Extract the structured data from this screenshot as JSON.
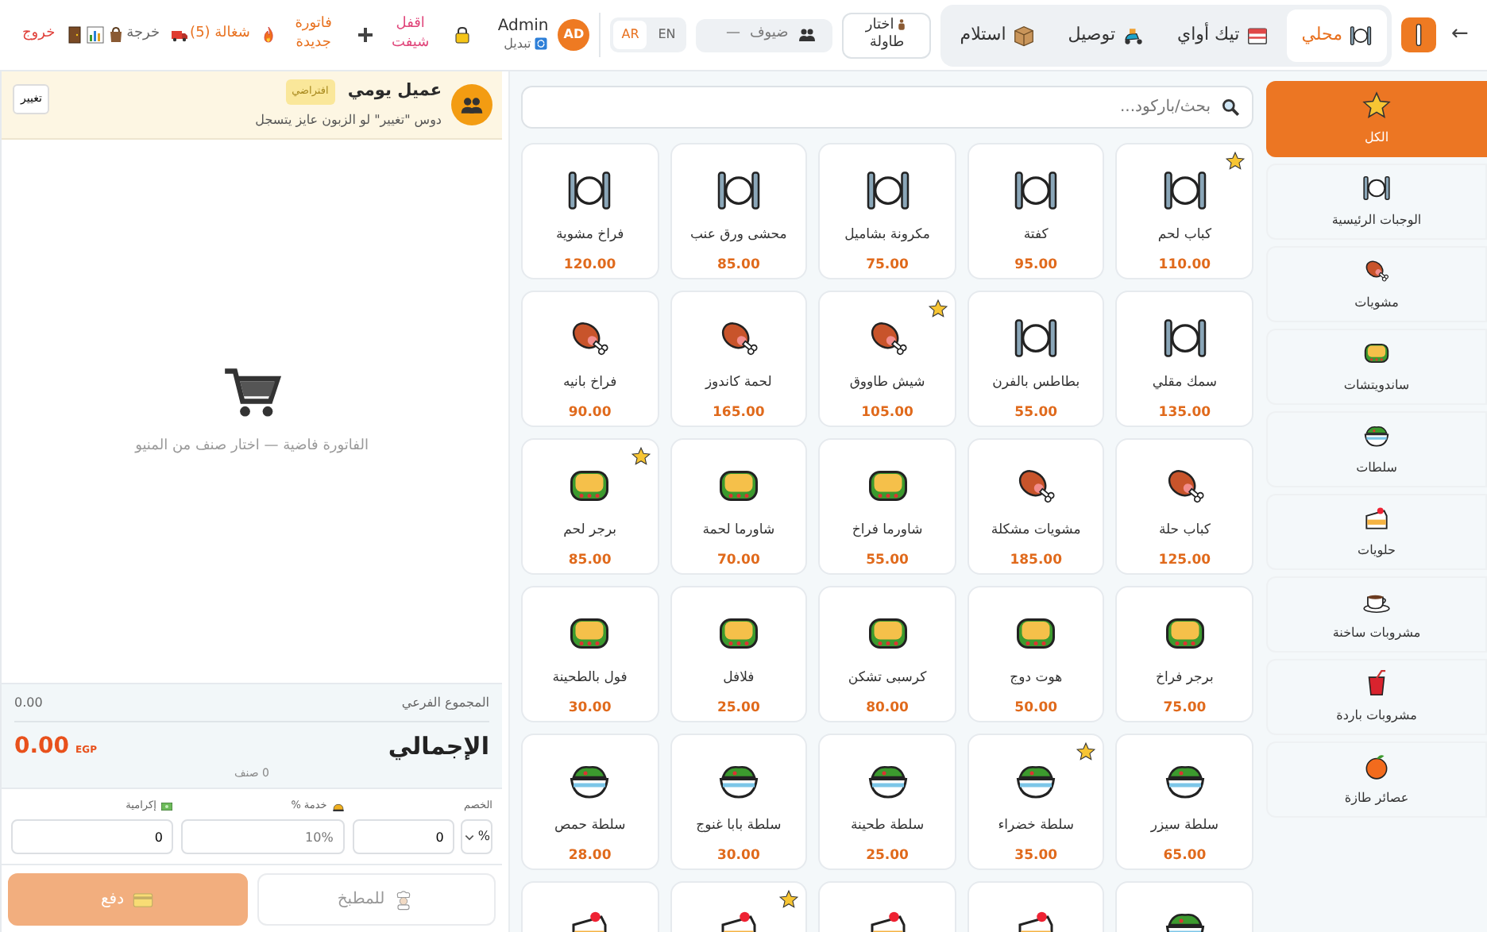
{
  "topbar": {
    "back": "←",
    "order_types": [
      {
        "label": "محلي",
        "kind": "dine",
        "selected": true
      },
      {
        "label": "تيك أواي",
        "kind": "takeaway",
        "selected": false
      },
      {
        "label": "توصيل",
        "kind": "delivery",
        "selected": false
      },
      {
        "label": "استلام",
        "kind": "pickup",
        "selected": false
      }
    ],
    "table_button": "اختار طاولة",
    "guests": {
      "label": "ضيوف",
      "value": "—"
    },
    "languages": [
      {
        "label": "EN",
        "selected": false
      },
      {
        "label": "AR",
        "selected": true
      }
    ],
    "user": {
      "initials": "AD",
      "name": "Admin",
      "switch_label": "تبديل"
    },
    "actions": [
      {
        "label": "اقفل شيفت",
        "kind": "lock"
      },
      {
        "label": "فاتورة جديدة",
        "kind": "new"
      },
      {
        "label": "شغالة (5)",
        "kind": "fire"
      },
      {
        "label": "خرجة",
        "kind": "truck"
      },
      {
        "kind": "bag"
      },
      {
        "kind": "chart"
      },
      {
        "label": "خروج",
        "kind": "door"
      }
    ]
  },
  "categories": [
    {
      "label": "الكل",
      "kind": "star",
      "selected": true
    },
    {
      "label": "الوجبات الرئيسية",
      "kind": "plate",
      "selected": false
    },
    {
      "label": "مشويات",
      "kind": "meat",
      "selected": false
    },
    {
      "label": "ساندويتشات",
      "kind": "sandwich",
      "selected": false
    },
    {
      "label": "سلطات",
      "kind": "salad",
      "selected": false
    },
    {
      "label": "حلويات",
      "kind": "cake",
      "selected": false
    },
    {
      "label": "مشروبات ساخنة",
      "kind": "coffee",
      "selected": false
    },
    {
      "label": "مشروبات باردة",
      "kind": "drink",
      "selected": false
    },
    {
      "label": "عصائر طازة",
      "kind": "orange",
      "selected": false
    }
  ],
  "search": {
    "placeholder": "بحث/باركود..."
  },
  "products": [
    {
      "name": "كباب لحم",
      "price": "110.00",
      "kind": "plate",
      "favorite": true
    },
    {
      "name": "كفتة",
      "price": "95.00",
      "kind": "plate",
      "favorite": false
    },
    {
      "name": "مكرونة بشاميل",
      "price": "75.00",
      "kind": "plate",
      "favorite": false
    },
    {
      "name": "محشى ورق عنب",
      "price": "85.00",
      "kind": "plate",
      "favorite": false
    },
    {
      "name": "فراخ مشوية",
      "price": "120.00",
      "kind": "plate",
      "favorite": false
    },
    {
      "name": "سمك مقلي",
      "price": "135.00",
      "kind": "plate",
      "favorite": false
    },
    {
      "name": "بطاطس بالفرن",
      "price": "55.00",
      "kind": "plate",
      "favorite": false
    },
    {
      "name": "شيش طاووق",
      "price": "105.00",
      "kind": "meat",
      "favorite": true
    },
    {
      "name": "لحمة كاندوز",
      "price": "165.00",
      "kind": "meat",
      "favorite": false
    },
    {
      "name": "فراخ بانيه",
      "price": "90.00",
      "kind": "meat",
      "favorite": false
    },
    {
      "name": "كباب حلة",
      "price": "125.00",
      "kind": "meat",
      "favorite": false
    },
    {
      "name": "مشويات مشكلة",
      "price": "185.00",
      "kind": "meat",
      "favorite": false
    },
    {
      "name": "شاورما فراخ",
      "price": "55.00",
      "kind": "sandwich",
      "favorite": false
    },
    {
      "name": "شاورما لحمة",
      "price": "70.00",
      "kind": "sandwich",
      "favorite": false
    },
    {
      "name": "برجر لحم",
      "price": "85.00",
      "kind": "sandwich",
      "favorite": true
    },
    {
      "name": "برجر فراخ",
      "price": "75.00",
      "kind": "sandwich",
      "favorite": false
    },
    {
      "name": "هوت دوج",
      "price": "50.00",
      "kind": "sandwich",
      "favorite": false
    },
    {
      "name": "كرسبى تشكن",
      "price": "80.00",
      "kind": "sandwich",
      "favorite": false
    },
    {
      "name": "فلافل",
      "price": "25.00",
      "kind": "sandwich",
      "favorite": false
    },
    {
      "name": "فول بالطحينة",
      "price": "30.00",
      "kind": "sandwich",
      "favorite": false
    },
    {
      "name": "سلطة سيزر",
      "price": "65.00",
      "kind": "salad",
      "favorite": false
    },
    {
      "name": "سلطة خضراء",
      "price": "35.00",
      "kind": "salad",
      "favorite": true
    },
    {
      "name": "سلطة طحينة",
      "price": "25.00",
      "kind": "salad",
      "favorite": false
    },
    {
      "name": "سلطة بابا غنوج",
      "price": "30.00",
      "kind": "salad",
      "favorite": false
    },
    {
      "name": "سلطة حمص",
      "price": "28.00",
      "kind": "salad",
      "favorite": false
    },
    {
      "kind": "salad",
      "favorite": false
    },
    {
      "kind": "cake",
      "favorite": false
    },
    {
      "kind": "cake",
      "favorite": false
    },
    {
      "kind": "cake",
      "favorite": true
    },
    {
      "kind": "cake",
      "favorite": false
    }
  ],
  "customer": {
    "name": "عميل يومي",
    "badge": "افتراضي",
    "hint": "دوس \"تغيير\" لو الزبون عايز يتسجل",
    "change_button": "تغيير"
  },
  "cart": {
    "empty_message": "الفاتورة فاضية — اختار صنف من المنيو"
  },
  "totals": {
    "subtotal_label": "المجموع الفرعي",
    "subtotal": "0.00",
    "total_label": "الإجمالي",
    "currency": "EGP",
    "total": "0.00",
    "item_count": "0 صنف"
  },
  "adjustments": {
    "discount": {
      "label": "الخصم",
      "type": "%",
      "value": "0"
    },
    "service": {
      "label": "خدمة %",
      "placeholder": "10%"
    },
    "tip": {
      "label": "إكرامية",
      "value": "0"
    }
  },
  "buttons": [
    {
      "label": "للمطبخ",
      "kind": "kitchen",
      "disabled": true
    },
    {
      "label": "دفع",
      "kind": "pay",
      "disabled": true
    }
  ]
}
